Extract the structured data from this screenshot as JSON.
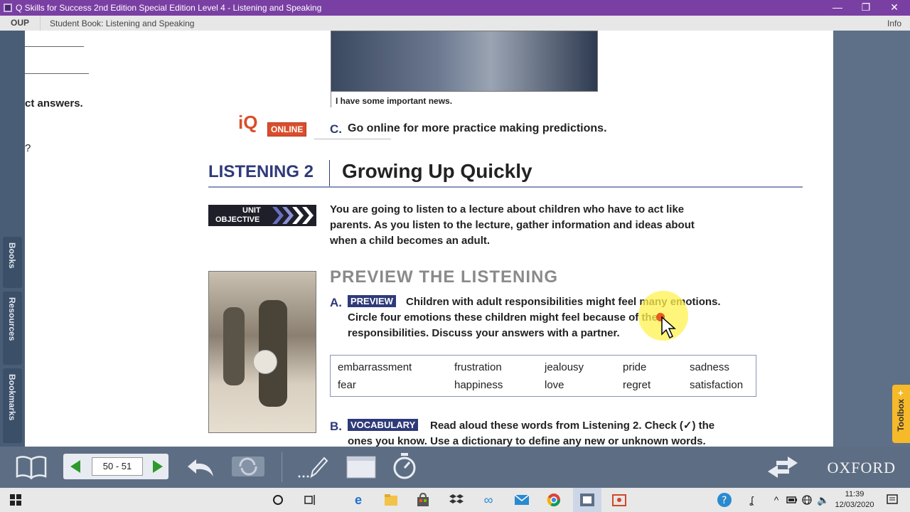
{
  "window": {
    "title": "Q Skills for Success 2nd Edition Special Edition Level 4 - Listening and Speaking",
    "minimize": "—",
    "restore": "❐",
    "close": "✕"
  },
  "menubar": {
    "oup": "OUP",
    "breadcrumb": "Student Book: Listening and Speaking",
    "info": "Info"
  },
  "side_tabs": {
    "books": "Books",
    "resources": "Resources",
    "bookmarks": "Bookmarks",
    "toolbox": "Toolbox"
  },
  "left_page": {
    "fragment1": "ct answers.",
    "fragment2": "?"
  },
  "main_page": {
    "caption": "I have some important news.",
    "iq": "iQ",
    "online": "ONLINE",
    "activity_c_letter": "C.",
    "activity_c_text": "Go online for more practice making predictions.",
    "section_label": "LISTENING 2",
    "section_title": "Growing Up Quickly",
    "unit_objective_line1": "UNIT",
    "unit_objective_line2": "OBJECTIVE",
    "objective_line1": "You are going to listen to a lecture about children who have to act like",
    "objective_line2": "parents. As you listen to the lecture, gather information and ideas about",
    "objective_line3": "when a child becomes an adult.",
    "preview_heading": "PREVIEW THE LISTENING",
    "activity_a_letter": "A.",
    "activity_a_label": "PREVIEW",
    "activity_a_line1": "Children with adult responsibilities might feel many emotions.",
    "activity_a_line2": "Circle four emotions these children might feel because of their",
    "activity_a_line3": "responsibilities. Discuss your answers with a partner.",
    "words": [
      "embarrassment",
      "frustration",
      "jealousy",
      "pride",
      "sadness",
      "fear",
      "happiness",
      "love",
      "regret",
      "satisfaction"
    ],
    "activity_b_letter": "B.",
    "activity_b_label": "VOCABULARY",
    "activity_b_line1": "Read aloud these words from Listening 2. Check (✓) the",
    "activity_b_line2": "ones you know. Use a dictionary to define any new or unknown words."
  },
  "bottom_toolbar": {
    "page_range": "50 - 51",
    "brand": "OXFORD"
  },
  "taskbar": {
    "time": "11:39",
    "date": "12/03/2020"
  },
  "colors": {
    "title_bar": "#7a3fa3",
    "accent_blue": "#2e3a7a",
    "iq_orange": "#d94e2c",
    "toolbox_yellow": "#f6b929"
  }
}
